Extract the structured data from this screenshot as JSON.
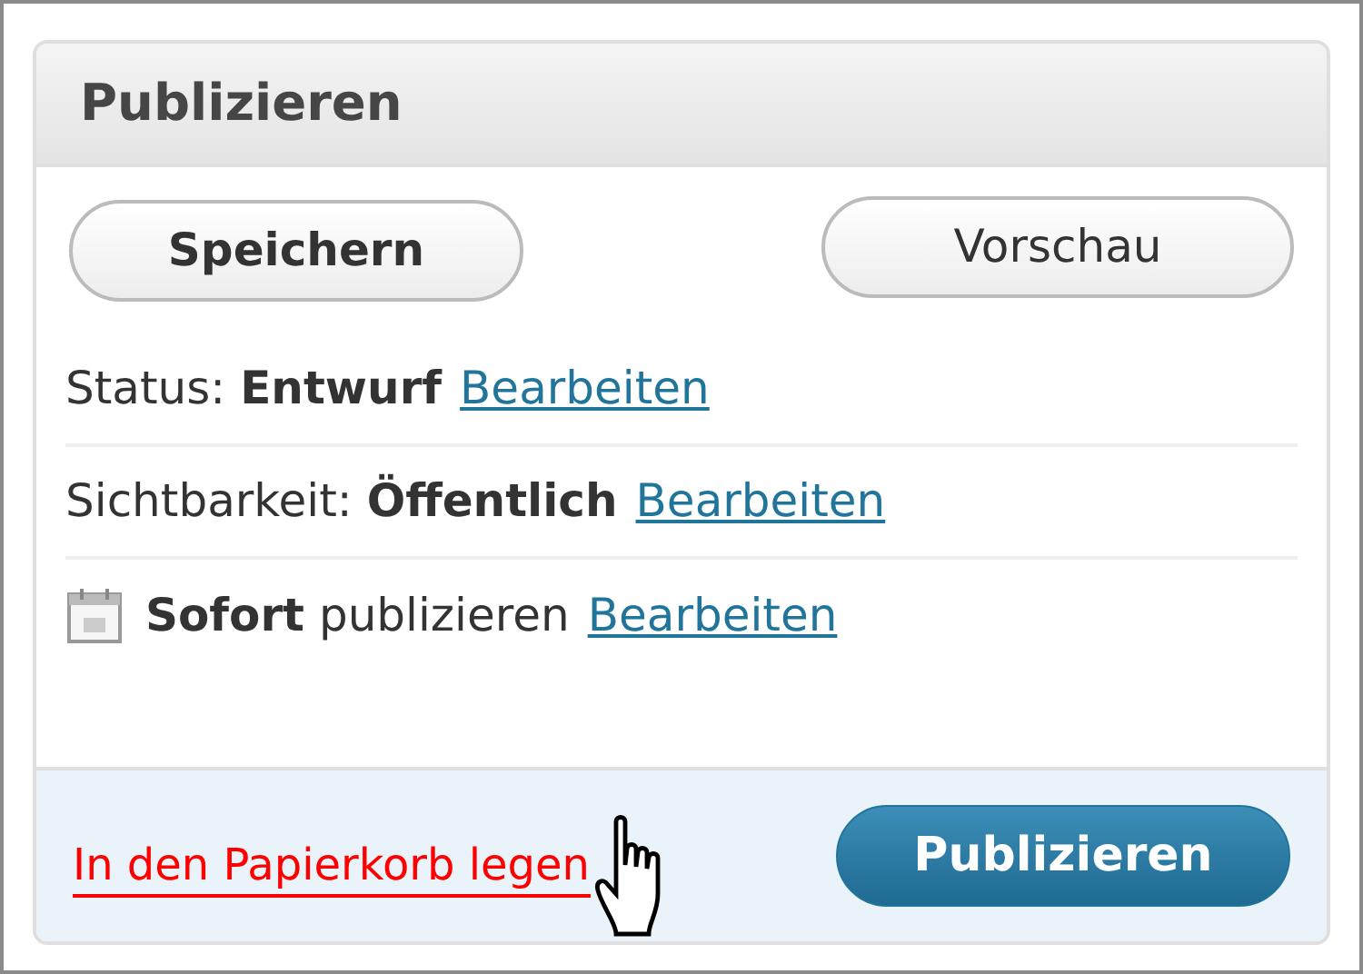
{
  "panel": {
    "title": "Publizieren"
  },
  "buttons": [
    {
      "label": "Speichern",
      "kind": "bold"
    },
    {
      "label": "Vorschau",
      "kind": "plain"
    }
  ],
  "rows": [
    {
      "kind": "field",
      "label": "Status:",
      "value": "Entwurf",
      "link": "Bearbeiten"
    },
    {
      "kind": "field",
      "label": "Sichtbarkeit:",
      "value": "Öffentlich",
      "link": "Bearbeiten"
    },
    {
      "kind": "schedule",
      "text": "**Sofort** publizieren",
      "link": "Bearbeiten"
    }
  ],
  "footer": {
    "trash_link": "In den Papierkorb legen",
    "publish_button": "Publizieren"
  }
}
